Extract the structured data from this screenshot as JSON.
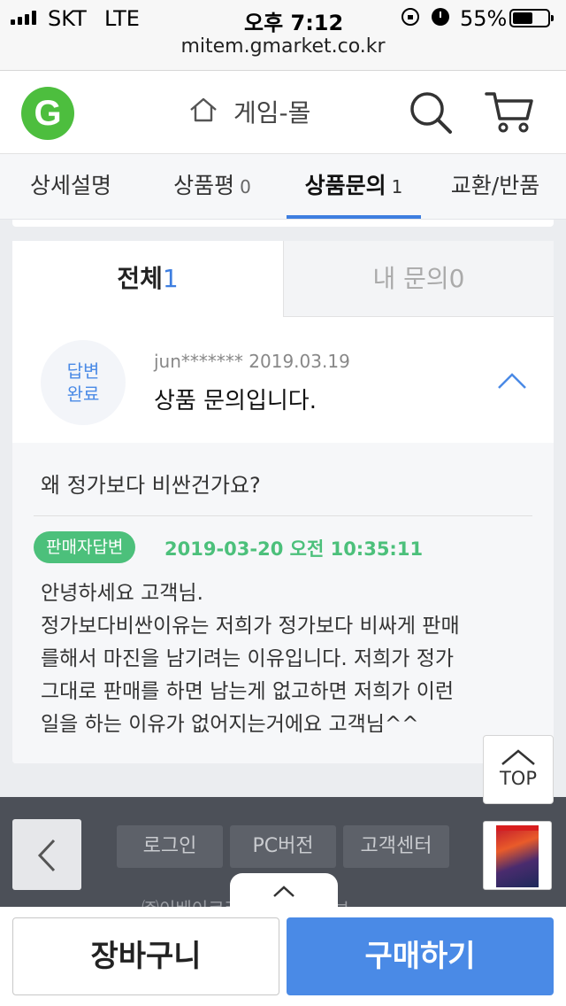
{
  "status_bar": {
    "carrier": "SKT",
    "network": "LTE",
    "time": "오후 7:12",
    "battery": "55%",
    "battery_level": 0.55
  },
  "url_bar": {
    "url": "mitem.gmarket.co.kr"
  },
  "header": {
    "logo": "G",
    "title": "게임-몰",
    "colors": {
      "logo_green": "#4dbe3e"
    }
  },
  "tabs": [
    {
      "label": "상세설명",
      "count": ""
    },
    {
      "label": "상품평",
      "count": "0"
    },
    {
      "label": "상품문의",
      "count": "1",
      "active": true
    },
    {
      "label": "교환/반품",
      "count": ""
    }
  ],
  "qa": {
    "subtabs": [
      {
        "label": "전체",
        "count": "1",
        "active": true
      },
      {
        "label": "내 문의",
        "count": "0"
      }
    ],
    "item": {
      "status_line1": "답변",
      "status_line2": "완료",
      "author": "jun*******",
      "date": "2019.03.19",
      "title": "상품 문의입니다.",
      "question": "왜 정가보다 비싼건가요?",
      "answer_badge": "판매자답변",
      "answer_datetime": "2019-03-20 오전 10:35:11",
      "answer_lines": [
        "안녕하세요 고객님.",
        "정가보다비싼이유는 저희가 정가보다 비싸게 판매",
        "를해서 마진을 남기려는 이유입니다. 저희가 정가",
        "그대로 판매를 하면 남는게 없고하면 저희가 이런",
        "일을 하는 이유가 없어지는거에요 고객님^^"
      ]
    }
  },
  "top_button": {
    "label": "TOP"
  },
  "footer": {
    "links": [
      "로그인",
      "PC버전",
      "고객센터"
    ],
    "sub_text": "㈜이베이코리아 사업자 정보"
  },
  "bottom_bar": {
    "cart_label": "장바구니",
    "buy_label": "구매하기",
    "colors": {
      "buy": "#4a8ae6"
    }
  }
}
